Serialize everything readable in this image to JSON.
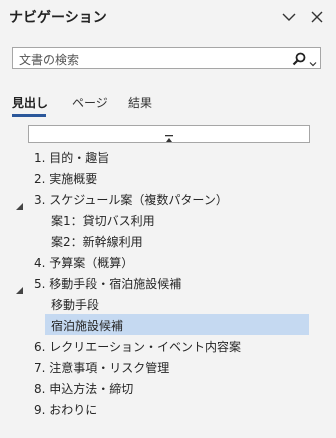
{
  "pane": {
    "title": "ナビゲーション"
  },
  "header": {
    "options_icon": "chevron-down-icon",
    "close_icon": "close-icon"
  },
  "search": {
    "placeholder": "文書の検索",
    "icon": "search-icon"
  },
  "tabs": [
    {
      "label": "見出し",
      "active": true
    },
    {
      "label": "ページ",
      "active": false
    },
    {
      "label": "結果",
      "active": false
    }
  ],
  "collapse_bar": {
    "icon": "collapse-all-icon"
  },
  "headings": [
    {
      "label": "1. 目的・趣旨",
      "level": 1,
      "expanded": null,
      "selected": false
    },
    {
      "label": "2. 実施概要",
      "level": 1,
      "expanded": null,
      "selected": false
    },
    {
      "label": "3. スケジュール案（複数パターン）",
      "level": 1,
      "expanded": true,
      "selected": false
    },
    {
      "label": "案1：貸切バス利用",
      "level": 2,
      "expanded": null,
      "selected": false
    },
    {
      "label": "案2：新幹線利用",
      "level": 2,
      "expanded": null,
      "selected": false
    },
    {
      "label": "4. 予算案（概算）",
      "level": 1,
      "expanded": null,
      "selected": false
    },
    {
      "label": "5. 移動手段・宿泊施設候補",
      "level": 1,
      "expanded": true,
      "selected": false
    },
    {
      "label": "移動手段",
      "level": 2,
      "expanded": null,
      "selected": false
    },
    {
      "label": "宿泊施設候補",
      "level": 2,
      "expanded": null,
      "selected": true
    },
    {
      "label": "6. レクリエーション・イベント内容案",
      "level": 1,
      "expanded": null,
      "selected": false
    },
    {
      "label": "7. 注意事項・リスク管理",
      "level": 1,
      "expanded": null,
      "selected": false
    },
    {
      "label": "8. 申込方法・締切",
      "level": 1,
      "expanded": null,
      "selected": false
    },
    {
      "label": "9. おわりに",
      "level": 1,
      "expanded": null,
      "selected": false
    }
  ],
  "colors": {
    "selection": "#c5d9f1",
    "accent": "#2b579a",
    "background": "#f3f3f3"
  }
}
